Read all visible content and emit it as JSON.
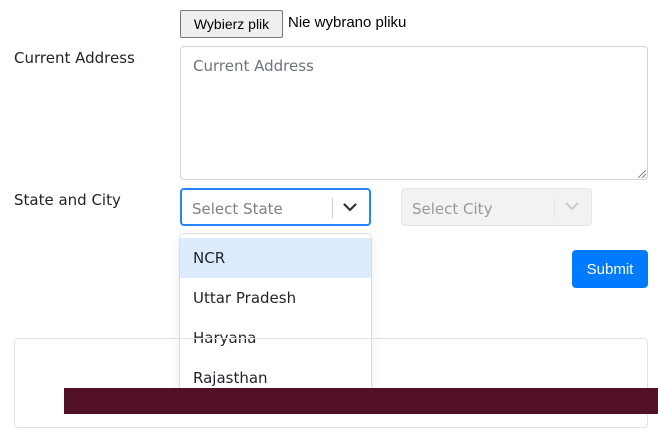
{
  "file_input": {
    "button_label": "Wybierz plik",
    "status_text": "Nie wybrano pliku"
  },
  "address": {
    "label": "Current Address",
    "placeholder": "Current Address"
  },
  "state_city": {
    "label": "State and City",
    "state_placeholder": "Select State",
    "city_placeholder": "Select City",
    "state_options": [
      "NCR",
      "Uttar Pradesh",
      "Haryana",
      "Rajasthan"
    ],
    "focused_option": "NCR"
  },
  "submit": {
    "label": "Submit"
  },
  "colors": {
    "accent": "#007bff",
    "select_focus_border": "#2684ff",
    "option_focus_bg": "#deebff",
    "banner": "#521126"
  }
}
